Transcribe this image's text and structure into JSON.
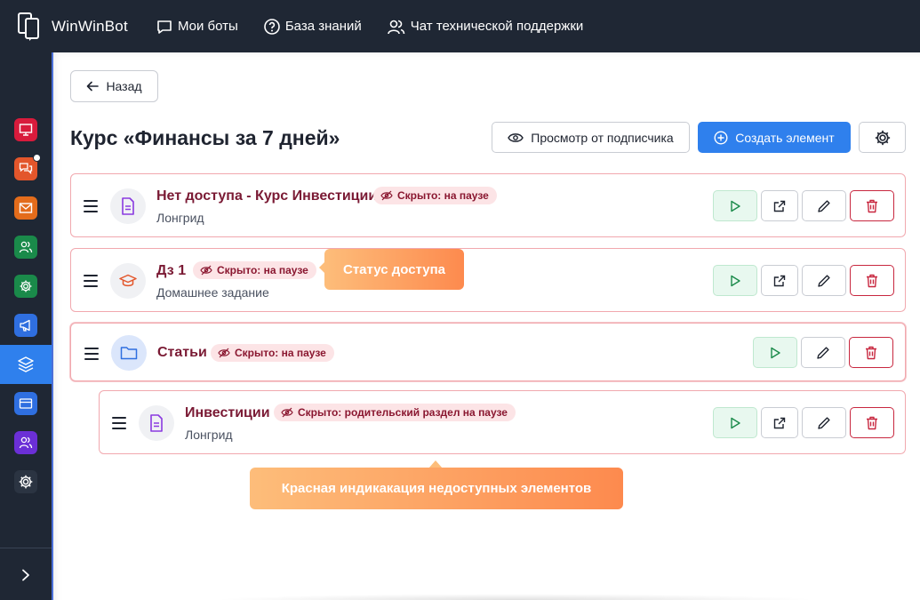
{
  "app": {
    "name": "WinWinBot"
  },
  "topnav": [
    {
      "label": "Мои боты",
      "icon": "chat-bubble-icon"
    },
    {
      "label": "База знаний",
      "icon": "help-circle-icon"
    },
    {
      "label": "Чат технической поддержки",
      "icon": "users-icon"
    }
  ],
  "sidebar": {
    "items": [
      {
        "icon": "presentation-icon",
        "color": "#d81b3c"
      },
      {
        "icon": "chat-icon",
        "color": "#e3562b",
        "has_dot": true
      },
      {
        "icon": "mail-icon",
        "color": "#e36c1b"
      },
      {
        "icon": "contacts-icon",
        "color": "#1a8a4a"
      },
      {
        "icon": "gear-icon",
        "color": "#1a8a4a"
      },
      {
        "icon": "megaphone-icon",
        "color": "#2f6fe0"
      },
      {
        "icon": "layers-icon",
        "color": "#2f80ed",
        "active": true
      },
      {
        "icon": "card-icon",
        "color": "#2f6fe0"
      },
      {
        "icon": "group-icon",
        "color": "#6b2fd6"
      },
      {
        "icon": "gear-icon",
        "color": "#4a5160"
      }
    ],
    "expand_icon": "chevron-right-icon"
  },
  "page": {
    "back_label": "Назад",
    "title": "Курс «Финансы за 7 дней»",
    "preview_label": "Просмотр от подписчика",
    "create_label": "Создать элемент"
  },
  "elements": [
    {
      "title": "Нет доступа - Курс Инвестиции",
      "subtitle": "Лонгрид",
      "badge": "Скрыто: на паузе",
      "type_icon": "document-icon"
    },
    {
      "title": "Дз 1",
      "subtitle": "Домашнее задание",
      "badge": "Скрыто: на паузе",
      "type_icon": "graduation-cap-icon"
    },
    {
      "title": "Статьи",
      "subtitle": "",
      "badge": "Скрыто: на паузе",
      "type_icon": "folder-icon"
    },
    {
      "title": "Инвестиции",
      "subtitle": "Лонгрид",
      "badge": "Скрыто: родительский раздел на паузе",
      "type_icon": "document-icon"
    }
  ],
  "callouts": {
    "access_status": "Статус доступа",
    "red_indication": "Красная индикакация недоступных элементов"
  },
  "colors": {
    "primary": "#2f80ed",
    "danger": "#c8273f",
    "hidden_title": "#7a1a34",
    "badge_bg": "#fce4e6",
    "callout_from": "#fdbd7a",
    "callout_to": "#fd8a4e",
    "topbar": "#1f2734"
  }
}
